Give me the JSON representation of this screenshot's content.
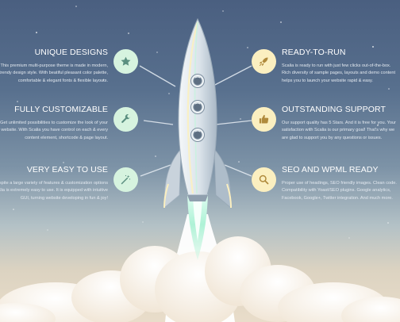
{
  "features": [
    {
      "id": "unique-designs",
      "title": "UNIQUE DESIGNS",
      "text": "This premium multi-purpose theme is made in modern, trendy design style. With beatiful pleasant color palette, comfortable & elegant fonts & flexible layouts.",
      "icon": "star-icon"
    },
    {
      "id": "fully-customizable",
      "title": "FULLY CUSTOMIZABLE",
      "text": "Get unlimited possibilities to customize the look of your website. With Scalia you have control on each & every content element, shortcode & page layout.",
      "icon": "wrench-icon"
    },
    {
      "id": "very-easy-to-use",
      "title": "VERY EASY TO USE",
      "text": "Despite a large variety of features & customization options Scalia is extremely easy to use. It is equipped with intuitive GUI, turning website developing in fun & joy!",
      "icon": "magic-wand-icon"
    },
    {
      "id": "ready-to-run",
      "title": "READY-TO-RUN",
      "text": "Scalia is ready to run with just few clicks out-of-the-box. Rich diversity of sample pages, layouts and demo content helps you to launch your website rapid & easy.",
      "icon": "rocket-icon"
    },
    {
      "id": "outstanding-support",
      "title": "OUTSTANDING SUPPORT",
      "text": "Our support quality has 5 Stars. And it is free for you. Your satisfaction with Scalia is our primary goal! That's why we are glad to support you by any questions or issues.",
      "icon": "thumbs-up-icon"
    },
    {
      "id": "seo-and-wpml-ready",
      "title": "SEO AND WPML READY",
      "text": "Proper use of headings, SEO friendly images. Clean code. Compatibility with Yoast/SEO plugins. Google analytics, Facebook, Google+, Twitter integration. And much more.",
      "icon": "magnifier-icon"
    }
  ],
  "colors": {
    "sky_top": "#4a5f80",
    "sky_bottom": "#e9ddca",
    "badge_mint": "#d6f3df",
    "badge_cream": "#fbefc0",
    "icon_teal": "#5b8f80",
    "icon_gold": "#b08a3c",
    "rocket_body": "#dde5ec",
    "flame": "#a8f0d3"
  }
}
